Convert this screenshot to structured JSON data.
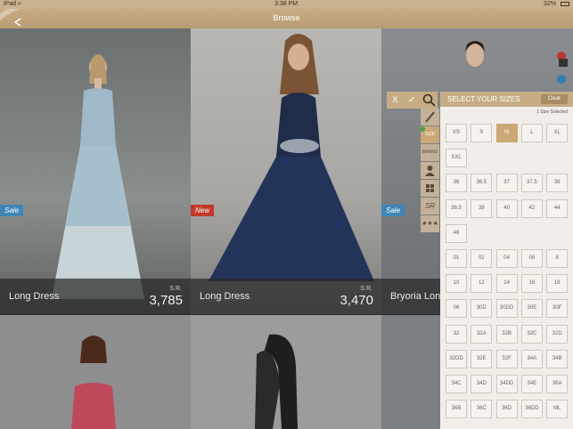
{
  "status": {
    "left": "iPad",
    "time": "3:38 PM",
    "battery": "32%"
  },
  "nav": {
    "title": "Browse"
  },
  "products": [
    {
      "name": "Long Dress",
      "currency": "S.R.",
      "price": "3,785",
      "badge": "Sale",
      "badge_color": "#3e86b5"
    },
    {
      "name": "Long Dress",
      "currency": "S.R.",
      "price": "3,470",
      "badge": "New",
      "badge_color": "#c0392b"
    },
    {
      "name": "Bryoria Long D",
      "badge": "Sale",
      "badge_color": "#3e86b5"
    }
  ],
  "toolbar": {
    "cancel_label": "X",
    "confirm_label": "✓"
  },
  "filters": [
    {
      "label": "SIZE",
      "icon": "size-icon"
    },
    {
      "label": "BRAND",
      "icon": "brand-icon"
    },
    {
      "label": "",
      "icon": "person-icon"
    },
    {
      "label": "",
      "icon": "category-grid-icon"
    },
    {
      "label": "SR",
      "icon": "price-icon"
    },
    {
      "label": "",
      "icon": "rating-stars-icon"
    }
  ],
  "size_panel": {
    "title": "SELECT YOUR SIZES",
    "clear_label": "Clear",
    "selected_count": "1 Size Selected",
    "sizes": [
      "XS",
      "S",
      "M",
      "L",
      "XL",
      "XXL",
      "36",
      "36.5",
      "37",
      "37.5",
      "38",
      "38.5",
      "39",
      "40",
      "42",
      "44",
      "46",
      "01",
      "02",
      "04",
      "08",
      "8",
      "10",
      "12",
      "14",
      "16",
      "18",
      "06",
      "30D",
      "30DD",
      "30E",
      "30F",
      "32",
      "32A",
      "32B",
      "32C",
      "32D",
      "32DD",
      "32E",
      "32F",
      "34A",
      "34B",
      "34C",
      "34D",
      "34DD",
      "34E",
      "36A",
      "36B",
      "36C",
      "36D",
      "36DD",
      "ML"
    ],
    "selected": "M"
  },
  "colors": {
    "accent": "#c7ad86",
    "selected": "#cba876"
  }
}
